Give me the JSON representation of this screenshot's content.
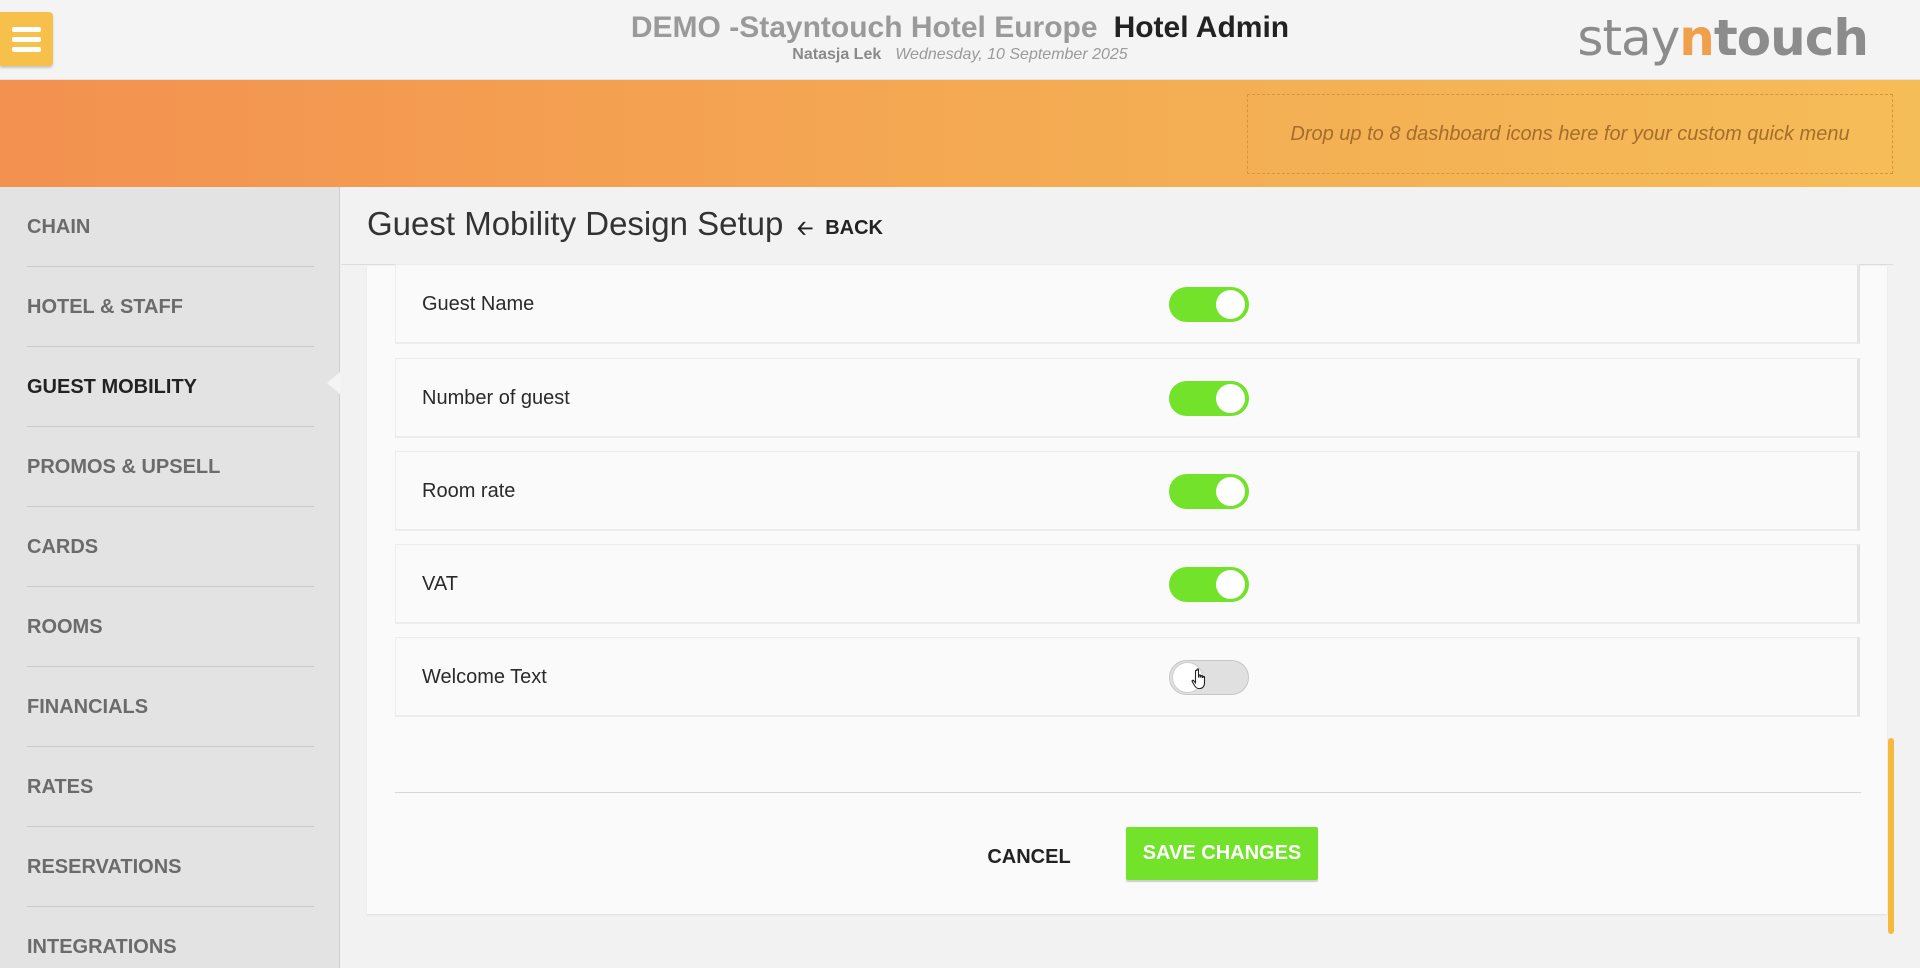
{
  "header": {
    "hotel_name": "DEMO -Stayntouch Hotel Europe",
    "app_name": "Hotel Admin",
    "user_name": "Natasja Lek",
    "date": "Wednesday, 10 September 2025",
    "brand_part1": "stay",
    "brand_part2": "n",
    "brand_part3": "touch",
    "menu_icon": "hamburger-icon"
  },
  "dashboard": {
    "dropzone_text": "Drop up to 8 dashboard icons here for your custom quick menu"
  },
  "sidebar": {
    "items": [
      {
        "label": "CHAIN",
        "active": false
      },
      {
        "label": "HOTEL & STAFF",
        "active": false
      },
      {
        "label": "GUEST MOBILITY",
        "active": true
      },
      {
        "label": "PROMOS & UPSELL",
        "active": false
      },
      {
        "label": "CARDS",
        "active": false
      },
      {
        "label": "ROOMS",
        "active": false
      },
      {
        "label": "FINANCIALS",
        "active": false
      },
      {
        "label": "RATES",
        "active": false
      },
      {
        "label": "RESERVATIONS",
        "active": false
      },
      {
        "label": "INTEGRATIONS",
        "active": false
      }
    ]
  },
  "page": {
    "title": "Guest Mobility Design Setup",
    "back_label": "BACK",
    "back_icon": "arrow-left-icon"
  },
  "settings": {
    "rows": [
      {
        "label": "Guest Name",
        "enabled": true
      },
      {
        "label": "Number of guest",
        "enabled": true
      },
      {
        "label": "Room rate",
        "enabled": true
      },
      {
        "label": "VAT",
        "enabled": true
      },
      {
        "label": "Welcome Text",
        "enabled": false
      }
    ]
  },
  "actions": {
    "cancel_label": "CANCEL",
    "save_label": "SAVE CHANGES"
  },
  "colors": {
    "accent_orange": "#f39150",
    "accent_yellow": "#f6c04a",
    "toggle_on": "#72e22a",
    "save_green": "#72e22a"
  }
}
